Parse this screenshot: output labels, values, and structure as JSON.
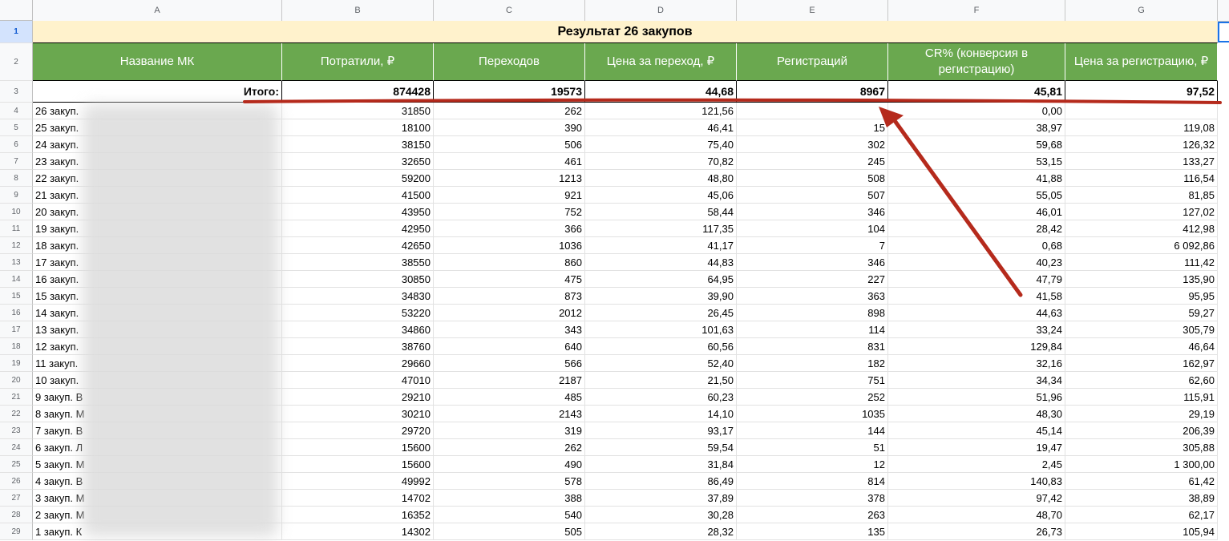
{
  "columns": [
    "A",
    "B",
    "C",
    "D",
    "E",
    "F",
    "G"
  ],
  "title": "Результат 26 закупов",
  "headers": [
    "Название МК",
    "Потратили, ₽",
    "Переходов",
    "Цена за переход, ₽",
    "Регистраций",
    "CR% (конверсия в регистрацию)",
    "Цена за регистрацию, ₽"
  ],
  "total": {
    "label": "Итого:",
    "values": [
      "874428",
      "19573",
      "44,68",
      "8967",
      "45,81",
      "97,52"
    ]
  },
  "row_numbers": [
    "1",
    "2",
    "3",
    "4",
    "5",
    "6",
    "7",
    "8",
    "9",
    "10",
    "11",
    "12",
    "13",
    "14",
    "15",
    "16",
    "17",
    "18",
    "19",
    "20",
    "21",
    "22",
    "23",
    "24",
    "25",
    "26",
    "27",
    "28",
    "29"
  ],
  "rows": [
    [
      "26 закуп.",
      "31850",
      "262",
      "121,56",
      "",
      "0,00",
      ""
    ],
    [
      "25 закуп.",
      "18100",
      "390",
      "46,41",
      "15",
      "38,97",
      "119,08"
    ],
    [
      "24 закуп.",
      "38150",
      "506",
      "75,40",
      "302",
      "59,68",
      "126,32"
    ],
    [
      "23 закуп.",
      "32650",
      "461",
      "70,82",
      "245",
      "53,15",
      "133,27"
    ],
    [
      "22 закуп.",
      "59200",
      "1213",
      "48,80",
      "508",
      "41,88",
      "116,54"
    ],
    [
      "21 закуп.",
      "41500",
      "921",
      "45,06",
      "507",
      "55,05",
      "81,85"
    ],
    [
      "20 закуп.",
      "43950",
      "752",
      "58,44",
      "346",
      "46,01",
      "127,02"
    ],
    [
      "19 закуп.",
      "42950",
      "366",
      "117,35",
      "104",
      "28,42",
      "412,98"
    ],
    [
      "18 закуп.",
      "42650",
      "1036",
      "41,17",
      "7",
      "0,68",
      "6 092,86"
    ],
    [
      "17 закуп.",
      "38550",
      "860",
      "44,83",
      "346",
      "40,23",
      "111,42"
    ],
    [
      "16 закуп.",
      "30850",
      "475",
      "64,95",
      "227",
      "47,79",
      "135,90"
    ],
    [
      "15 закуп.",
      "34830",
      "873",
      "39,90",
      "363",
      "41,58",
      "95,95"
    ],
    [
      "14 закуп.",
      "53220",
      "2012",
      "26,45",
      "898",
      "44,63",
      "59,27"
    ],
    [
      "13 закуп.",
      "34860",
      "343",
      "101,63",
      "114",
      "33,24",
      "305,79"
    ],
    [
      "12 закуп.",
      "38760",
      "640",
      "60,56",
      "831",
      "129,84",
      "46,64"
    ],
    [
      "11 закуп.",
      "29660",
      "566",
      "52,40",
      "182",
      "32,16",
      "162,97"
    ],
    [
      "10 закуп.",
      "47010",
      "2187",
      "21,50",
      "751",
      "34,34",
      "62,60"
    ],
    [
      "9 закуп. В",
      "29210",
      "485",
      "60,23",
      "252",
      "51,96",
      "115,91"
    ],
    [
      "8 закуп. М",
      "30210",
      "2143",
      "14,10",
      "1035",
      "48,30",
      "29,19"
    ],
    [
      "7 закуп. В",
      "29720",
      "319",
      "93,17",
      "144",
      "45,14",
      "206,39"
    ],
    [
      "6 закуп. Л",
      "15600",
      "262",
      "59,54",
      "51",
      "19,47",
      "305,88"
    ],
    [
      "5 закуп. М",
      "15600",
      "490",
      "31,84",
      "12",
      "2,45",
      "1 300,00"
    ],
    [
      "4 закуп. В",
      "49992",
      "578",
      "86,49",
      "814",
      "140,83",
      "61,42"
    ],
    [
      "3 закуп. М",
      "14702",
      "388",
      "37,89",
      "378",
      "97,42",
      "38,89"
    ],
    [
      "2 закуп. М",
      "16352",
      "540",
      "30,28",
      "263",
      "48,70",
      "62,17"
    ],
    [
      "1 закуп. К",
      "14302",
      "505",
      "28,32",
      "135",
      "26,73",
      "105,94"
    ]
  ],
  "colors": {
    "header_green": "#6aa84f",
    "title_yellow": "#fff2cc",
    "annotation_red": "#b52a1c"
  }
}
